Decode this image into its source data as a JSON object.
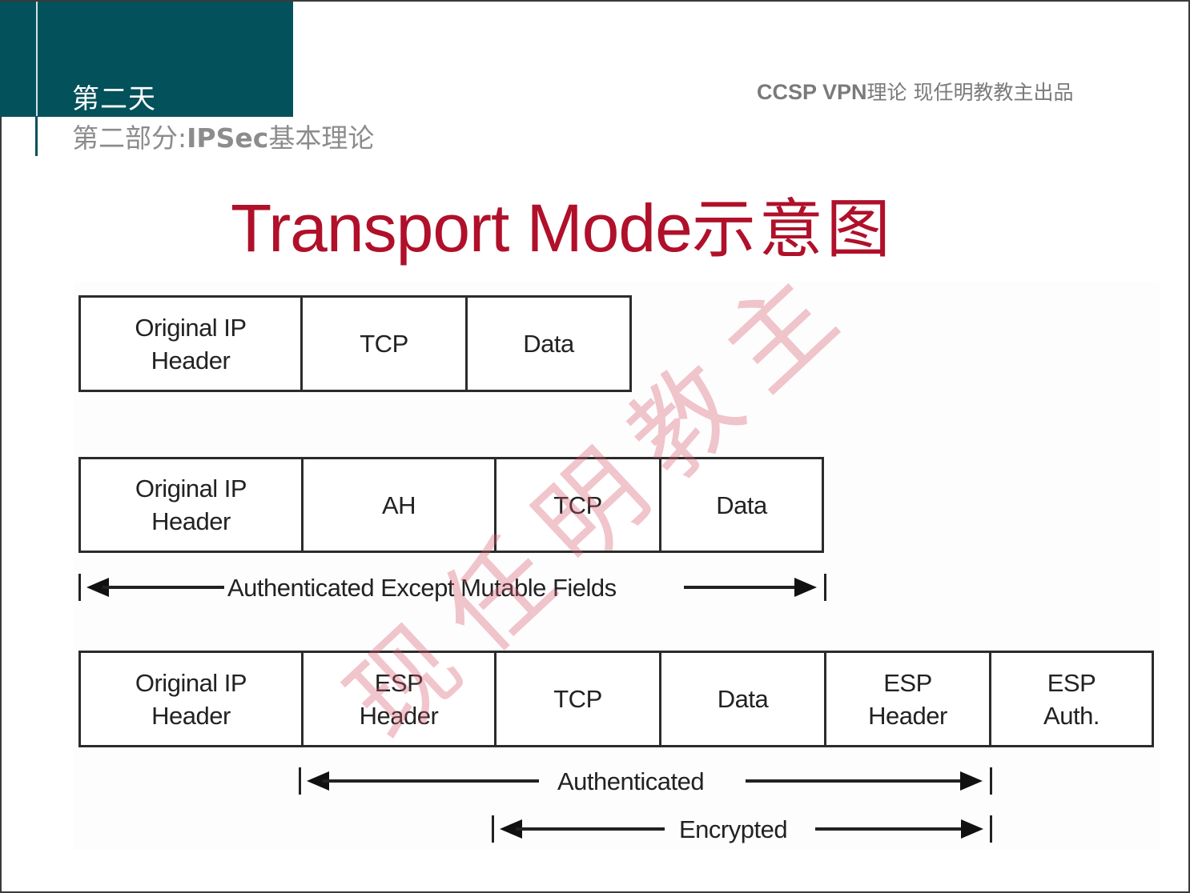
{
  "header": {
    "day_label": "第二天",
    "section_prefix": "第二部分:",
    "section_en": "IPSec",
    "section_suffix": "基本理论",
    "brand_en": "CCSP VPN",
    "brand_cn": "理论  现任明教教主出品"
  },
  "title": {
    "en": "Transport Mode",
    "cn": "示意图"
  },
  "watermark": "现任明教主",
  "diagram": {
    "original_packet": {
      "cells": [
        "Original IP\nHeader",
        "TCP",
        "Data"
      ]
    },
    "ah_packet": {
      "cells": [
        "Original IP\nHeader",
        "AH",
        "TCP",
        "Data"
      ],
      "span_label": "Authenticated Except Mutable Fields"
    },
    "esp_packet": {
      "cells": [
        "Original IP\nHeader",
        "ESP\nHeader",
        "TCP",
        "Data",
        "ESP\nHeader",
        "ESP\nAuth."
      ],
      "authenticated_label": "Authenticated",
      "encrypted_label": "Encrypted"
    }
  },
  "colors": {
    "header_block": "#03515a",
    "title": "#b0102a",
    "watermark": "#d75a6e"
  }
}
